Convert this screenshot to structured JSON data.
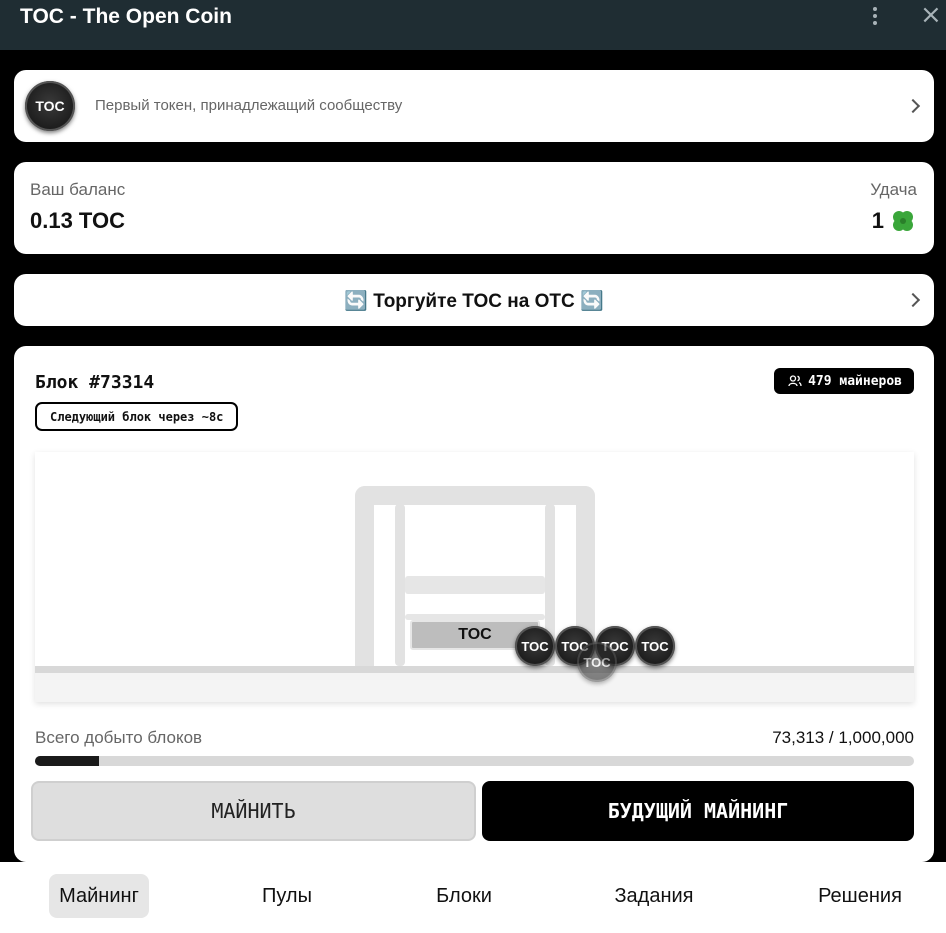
{
  "window": {
    "title": "TOC - The Open Coin"
  },
  "token": {
    "ticker": "TOC",
    "tagline": "Первый токен, принадлежащий сообществу"
  },
  "balance": {
    "label": "Ваш баланс",
    "value": "0.13 TOC",
    "luck_label": "Удача",
    "luck_value": "1",
    "luck_icon": "four-leaf-clover-icon"
  },
  "trade": {
    "label": "🔄 Торгуйте TOC на OTC 🔄"
  },
  "block": {
    "title": "Блок  #73314",
    "miners": "479 майнеров",
    "next": "Следующий блок через ~8с",
    "bin_label": "TOC",
    "coin_label": "TOC",
    "mined_label": "Всего добыто блоков",
    "mined_value": "73,313 / 1,000,000",
    "mined_progress": 0.073313
  },
  "actions": {
    "mine": "МАЙНИТЬ",
    "future": "БУДУЩИЙ МАЙНИНГ"
  },
  "nav": {
    "items": [
      {
        "label": "Майнинг",
        "active": true
      },
      {
        "label": "Пулы"
      },
      {
        "label": "Блоки"
      },
      {
        "label": "Задания"
      },
      {
        "label": "Решения"
      }
    ]
  },
  "colors": {
    "title_bar": "#1f2d33",
    "accent": "#000000",
    "card": "#ffffff",
    "clover": "#3aa63a"
  }
}
